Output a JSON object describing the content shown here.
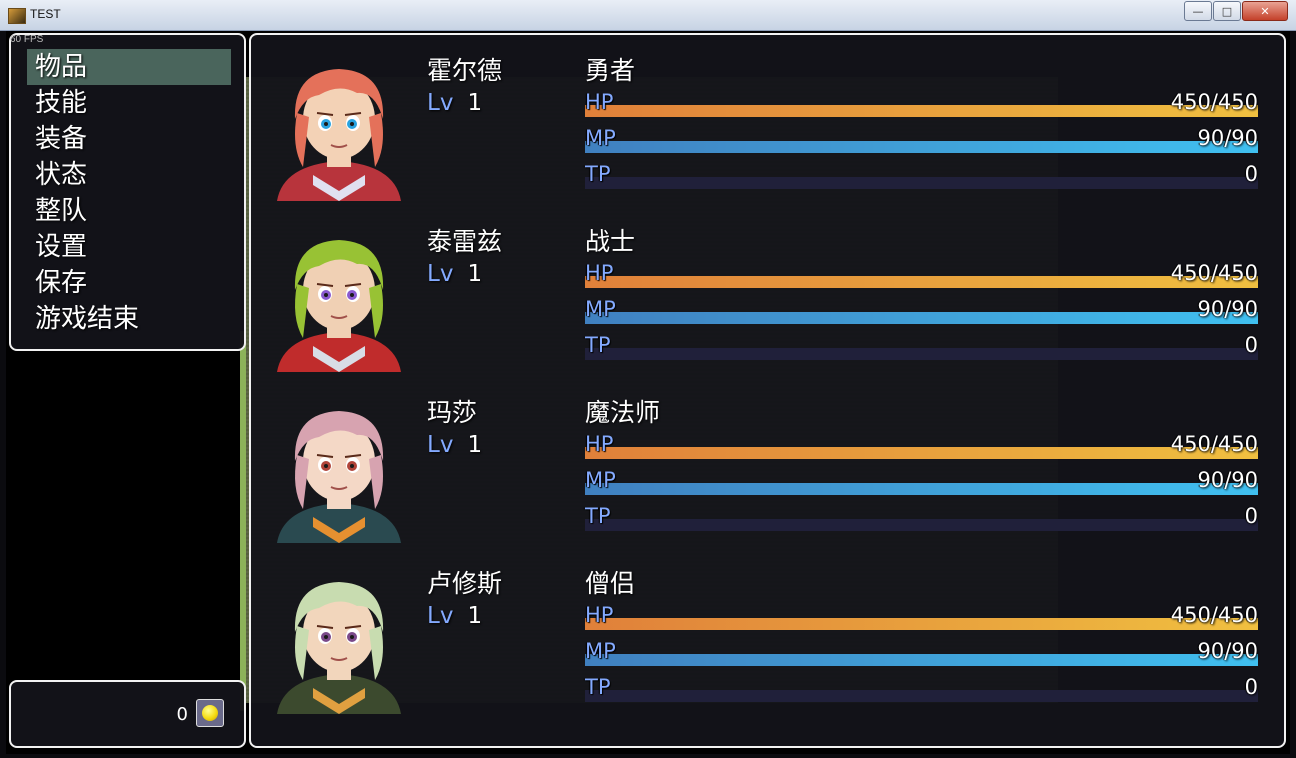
{
  "window": {
    "title": "TEST",
    "buttons": {
      "minimize": "—",
      "maximize": "□",
      "close": "✕"
    }
  },
  "fps": "60 FPS",
  "menu": {
    "commands": [
      "物品",
      "技能",
      "装备",
      "状态",
      "整队",
      "设置",
      "保存",
      "游戏结束"
    ],
    "selected_index": 0
  },
  "gold": {
    "value": "0",
    "icon": "gold-coin-icon"
  },
  "party": [
    {
      "name": "霍尔德",
      "class": "勇者",
      "lv_label": "Lv",
      "level": "1",
      "hp": {
        "label": "HP",
        "value": "450/450",
        "ratio": 1.0
      },
      "mp": {
        "label": "MP",
        "value": "90/90",
        "ratio": 1.0
      },
      "tp": {
        "label": "TP",
        "value": "0",
        "ratio": 0.0
      },
      "palette": {
        "hair": "#e4715a",
        "skin": "#f3d2b6",
        "outfit": "#b8343c",
        "accent": "#e0e0f0",
        "eyes": "#29a3e0"
      }
    },
    {
      "name": "泰雷兹",
      "class": "战士",
      "lv_label": "Lv",
      "level": "1",
      "hp": {
        "label": "HP",
        "value": "450/450",
        "ratio": 1.0
      },
      "mp": {
        "label": "MP",
        "value": "90/90",
        "ratio": 1.0
      },
      "tp": {
        "label": "TP",
        "value": "0",
        "ratio": 0.0
      },
      "palette": {
        "hair": "#98c234",
        "skin": "#f0d0b4",
        "outfit": "#c02c2c",
        "accent": "#d8dde6",
        "eyes": "#8a5ad0"
      }
    },
    {
      "name": "玛莎",
      "class": "魔法师",
      "lv_label": "Lv",
      "level": "1",
      "hp": {
        "label": "HP",
        "value": "450/450",
        "ratio": 1.0
      },
      "mp": {
        "label": "MP",
        "value": "90/90",
        "ratio": 1.0
      },
      "tp": {
        "label": "TP",
        "value": "0",
        "ratio": 0.0
      },
      "palette": {
        "hair": "#d7a3b0",
        "skin": "#f4d8c6",
        "outfit": "#2a4a50",
        "accent": "#e69030",
        "eyes": "#b0443a"
      }
    },
    {
      "name": "卢修斯",
      "class": "僧侣",
      "lv_label": "Lv",
      "level": "1",
      "hp": {
        "label": "HP",
        "value": "450/450",
        "ratio": 1.0
      },
      "mp": {
        "label": "MP",
        "value": "90/90",
        "ratio": 1.0
      },
      "tp": {
        "label": "TP",
        "value": "0",
        "ratio": 0.0
      },
      "palette": {
        "hair": "#c8dcb0",
        "skin": "#f2d6bc",
        "outfit": "#3c4a2e",
        "accent": "#e0a040",
        "eyes": "#7a4a8a"
      }
    }
  ]
}
